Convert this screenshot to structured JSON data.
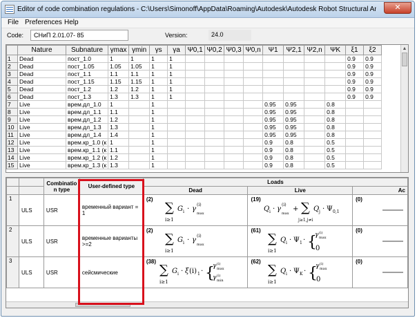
{
  "window": {
    "title": "Editor of code combination regulations - C:\\Users\\Simonoff\\AppData\\Roaming\\Autodesk\\Autodesk Robot Structural Analys...",
    "close_label": "✕"
  },
  "menu": [
    "File",
    "Preferences",
    "Help"
  ],
  "code": {
    "label": "Code:",
    "value": "СНиП 2.01.07- 85",
    "version_label": "Version:",
    "version_value": "24.0"
  },
  "upper_grid": {
    "headers": [
      "",
      "Nature",
      "Subnature",
      "γmax",
      "γmin",
      "γs",
      "γa",
      "Ψ0,1",
      "Ψ0,2",
      "Ψ0,3",
      "Ψ0,n",
      "Ψ1",
      "Ψ2,1",
      "Ψ2,n",
      "ΨK",
      "ξ1",
      "ξ2"
    ],
    "rows": [
      [
        "1",
        "Dead",
        "пост_1.0",
        "1",
        "1",
        "1",
        "1",
        "",
        "",
        "",
        "",
        "",
        "",
        "",
        "",
        "0.9",
        "0.9"
      ],
      [
        "2",
        "Dead",
        "пост_1.05",
        "1.05",
        "1.05",
        "1",
        "1",
        "",
        "",
        "",
        "",
        "",
        "",
        "",
        "",
        "0.9",
        "0.9"
      ],
      [
        "3",
        "Dead",
        "пост_1.1",
        "1.1",
        "1.1",
        "1",
        "1",
        "",
        "",
        "",
        "",
        "",
        "",
        "",
        "",
        "0.9",
        "0.9"
      ],
      [
        "4",
        "Dead",
        "пост_1.15",
        "1.15",
        "1.15",
        "1",
        "1",
        "",
        "",
        "",
        "",
        "",
        "",
        "",
        "",
        "0.9",
        "0.9"
      ],
      [
        "5",
        "Dead",
        "пост_1.2",
        "1.2",
        "1.2",
        "1",
        "1",
        "",
        "",
        "",
        "",
        "",
        "",
        "",
        "",
        "0.9",
        "0.9"
      ],
      [
        "6",
        "Dead",
        "пост_1.3",
        "1.3",
        "1.3",
        "1",
        "1",
        "",
        "",
        "",
        "",
        "",
        "",
        "",
        "",
        "0.9",
        "0.9"
      ],
      [
        "7",
        "Live",
        "врем.дл_1.0",
        "1",
        "",
        "1",
        "",
        "",
        "",
        "",
        "",
        "0.95",
        "0.95",
        "",
        "0.8",
        "",
        ""
      ],
      [
        "8",
        "Live",
        "врем.дл_1.1",
        "1.1",
        "",
        "1",
        "",
        "",
        "",
        "",
        "",
        "0.95",
        "0.95",
        "",
        "0.8",
        "",
        ""
      ],
      [
        "9",
        "Live",
        "врем.дл_1.2",
        "1.2",
        "",
        "1",
        "",
        "",
        "",
        "",
        "",
        "0.95",
        "0.95",
        "",
        "0.8",
        "",
        ""
      ],
      [
        "10",
        "Live",
        "врем.дл_1.3",
        "1.3",
        "",
        "1",
        "",
        "",
        "",
        "",
        "",
        "0.95",
        "0.95",
        "",
        "0.8",
        "",
        ""
      ],
      [
        "11",
        "Live",
        "врем.дл_1.4",
        "1.4",
        "",
        "1",
        "",
        "",
        "",
        "",
        "",
        "0.95",
        "0.95",
        "",
        "0.8",
        "",
        ""
      ],
      [
        "12",
        "Live",
        "врем.кр_1.0 (к",
        "1",
        "",
        "1",
        "",
        "",
        "",
        "",
        "",
        "0.9",
        "0.8",
        "",
        "0.5",
        "",
        ""
      ],
      [
        "13",
        "Live",
        "врем.кр_1.1 (к",
        "1.1",
        "",
        "1",
        "",
        "",
        "",
        "",
        "",
        "0.9",
        "0.8",
        "",
        "0.5",
        "",
        ""
      ],
      [
        "14",
        "Live",
        "врем.кр_1.2 (к",
        "1.2",
        "",
        "1",
        "",
        "",
        "",
        "",
        "",
        "0.9",
        "0.8",
        "",
        "0.5",
        "",
        ""
      ],
      [
        "15",
        "Live",
        "врем.кр_1.3 (к",
        "1.3",
        "",
        "1",
        "",
        "",
        "",
        "",
        "",
        "0.9",
        "0.8",
        "",
        "0.5",
        "",
        ""
      ]
    ]
  },
  "lower_grid": {
    "headers": {
      "combination_type": "Combinatio n type",
      "user_defined_type": "User-defined type",
      "loads": "Loads",
      "dead": "Dead",
      "live": "Live",
      "accidental": "Ac"
    },
    "rows": [
      {
        "num": "1",
        "type": "ULS",
        "code": "USR",
        "user_type": "временный вариант = 1",
        "dead_num": "(2)",
        "live_num": "(19)",
        "acc_num": "(0)"
      },
      {
        "num": "2",
        "type": "ULS",
        "code": "USR",
        "user_type": "временные варианты >=2",
        "dead_num": "(2)",
        "live_num": "(61)",
        "acc_num": "(0)"
      },
      {
        "num": "3",
        "type": "ULS",
        "code": "USR",
        "user_type": "сейсмические",
        "dead_num": "(38)",
        "live_num": "(62)",
        "acc_num": "(0)"
      }
    ],
    "scroll_label": "..."
  },
  "colors": {
    "highlight_box": "#d8101c",
    "titlebar": "#bcd2ea",
    "close_button": "#c7412a"
  }
}
